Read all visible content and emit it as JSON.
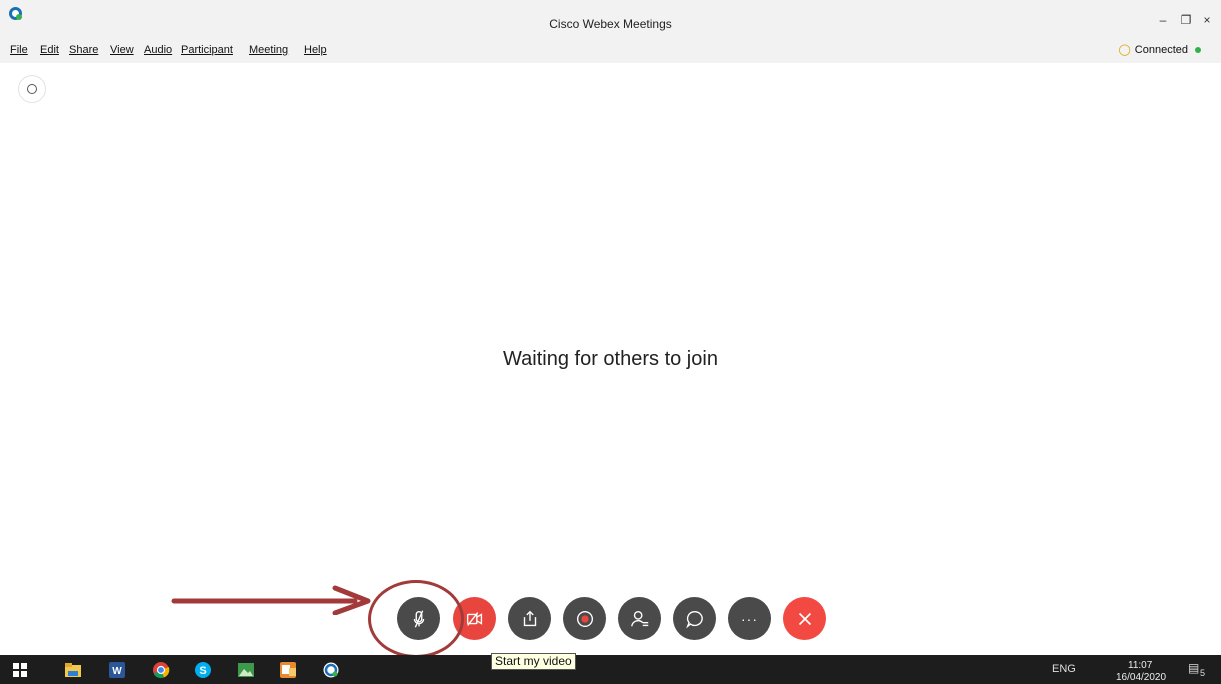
{
  "window": {
    "title": "Cisco Webex Meetings",
    "minimize": "–",
    "restore": "❐",
    "close": "×"
  },
  "menu": {
    "items": [
      "File",
      "Edit",
      "Share",
      "View",
      "Audio",
      "Participant",
      "Meeting",
      "Help"
    ]
  },
  "status": {
    "connection": "Connected",
    "connected_color": "#2fb24a"
  },
  "main": {
    "waiting_text": "Waiting for others to join"
  },
  "controls": {
    "tooltip": "Start my video",
    "more_label": "···",
    "buttons": [
      "mute-icon",
      "video-off-icon",
      "share-icon",
      "record-icon",
      "participants-icon",
      "chat-icon",
      "more-icon",
      "end-meeting-icon"
    ]
  },
  "taskbar": {
    "language": "ENG",
    "time": "11:07",
    "date": "16/04/2020",
    "notification_count": "5"
  },
  "colors": {
    "control_dark": "#4a4a4a",
    "control_red": "#e8453f",
    "annotation": "#a33a3a"
  }
}
